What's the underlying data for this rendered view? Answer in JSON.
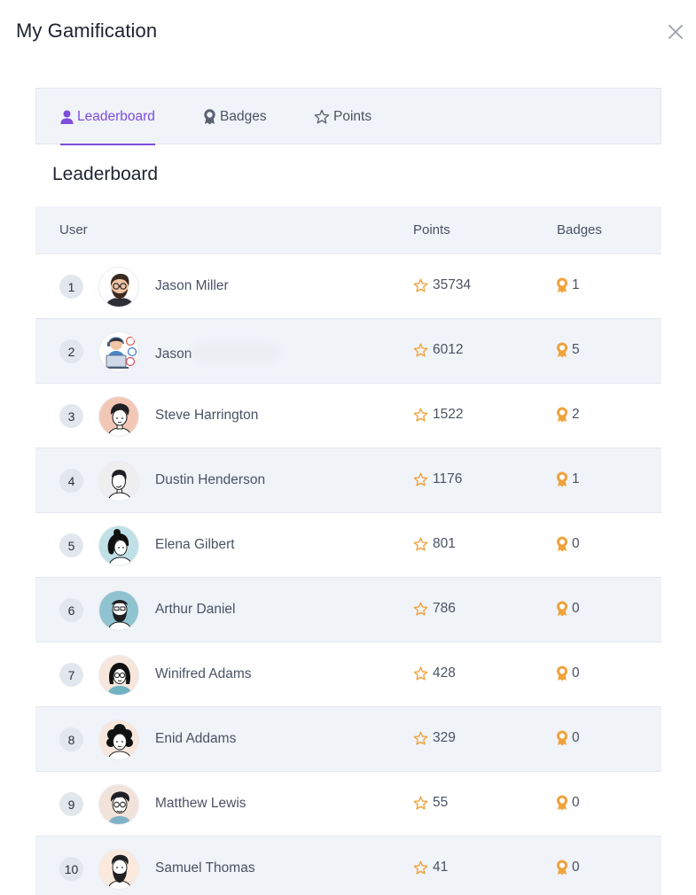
{
  "modal": {
    "title": "My Gamification"
  },
  "tabs": [
    {
      "label": "Leaderboard",
      "icon": "user-icon",
      "active": true
    },
    {
      "label": "Badges",
      "icon": "badge-icon",
      "active": false
    },
    {
      "label": "Points",
      "icon": "star-icon",
      "active": false
    }
  ],
  "section": {
    "title": "Leaderboard"
  },
  "table": {
    "headers": {
      "user": "User",
      "points": "Points",
      "badges": "Badges"
    },
    "rows": [
      {
        "rank": "1",
        "name": "Jason Miller",
        "points": "35734",
        "badges": "1"
      },
      {
        "rank": "2",
        "name": "Jason",
        "name_redacted": true,
        "points": "6012",
        "badges": "5"
      },
      {
        "rank": "3",
        "name": "Steve Harrington",
        "points": "1522",
        "badges": "2"
      },
      {
        "rank": "4",
        "name": "Dustin Henderson",
        "points": "1176",
        "badges": "1"
      },
      {
        "rank": "5",
        "name": "Elena Gilbert",
        "points": "801",
        "badges": "0"
      },
      {
        "rank": "6",
        "name": "Arthur Daniel",
        "points": "786",
        "badges": "0"
      },
      {
        "rank": "7",
        "name": "Winifred Adams",
        "points": "428",
        "badges": "0"
      },
      {
        "rank": "8",
        "name": "Enid Addams",
        "points": "329",
        "badges": "0"
      },
      {
        "rank": "9",
        "name": "Matthew Lewis",
        "points": "55",
        "badges": "0"
      },
      {
        "rank": "10",
        "name": "Samuel Thomas",
        "points": "41",
        "badges": "0"
      }
    ]
  },
  "colors": {
    "accent": "#7c4ddb",
    "star": "#f0a23a",
    "medal": "#f0a23a",
    "row_alt": "#f0f3f8"
  },
  "icons": {
    "close": "close-icon",
    "points": "star-icon",
    "badges": "medal-icon"
  }
}
